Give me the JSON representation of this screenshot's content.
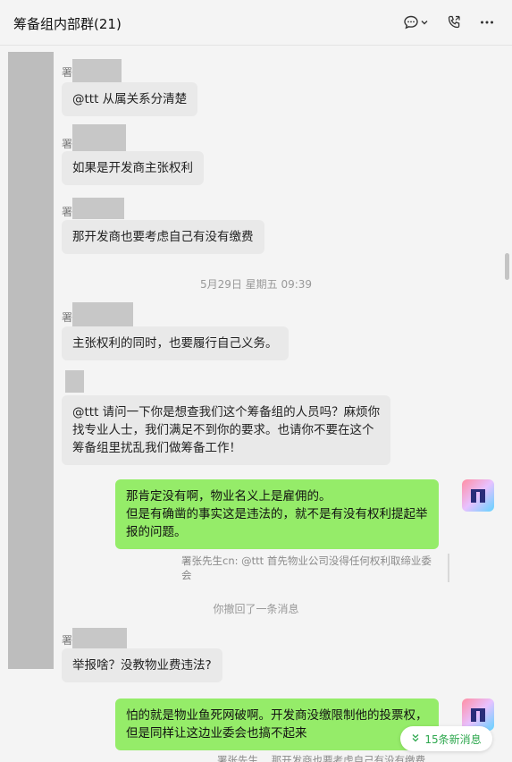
{
  "header": {
    "title": "筹备组内部群(21)"
  },
  "timestamp": "5月29日 星期五 09:39",
  "messages": {
    "m1": {
      "sender_initial": "署",
      "text": "@ttt 从属关系分清楚"
    },
    "m2": {
      "sender_initial": "署",
      "text": "如果是开发商主张权利"
    },
    "m3": {
      "sender_initial": "署",
      "text": "那开发商也要考虑自己有没有缴费"
    },
    "m4": {
      "sender_initial": "署",
      "text": "主张权利的同时，也要履行自己义务。"
    },
    "m5": {
      "sender_initial": "",
      "lines": [
        "@ttt 请问一下你是想查我们这个筹备组的人员吗？麻烦你",
        "找专业人士，我们满足不到你的要求。也请你不要在这个",
        "筹备组里扰乱我们做筹备工作！"
      ]
    },
    "m6": {
      "lines": [
        "那肯定没有啊，物业名义上是雇佣的。",
        "但是有确凿的事实这是违法的，就不是有没有权利提起举",
        "报的问题。"
      ],
      "quote_lines": [
        "署张先生cn: @ttt 首先物业公司没得任何权利取缔业委",
        "会"
      ]
    },
    "recall_notice": "你撤回了一条消息",
    "m7": {
      "sender_initial": "署",
      "text": "举报啥？没教物业费违法?"
    },
    "m8": {
      "lines": [
        "怕的就是物业鱼死网破啊。开发商没缴限制他的投票权，",
        "但是同样让这边业委会也搞不起来"
      ],
      "quote_partial": "署张先生...   那开发商也要考虑自己有没有缴费"
    }
  },
  "new_messages_label": "15条新消息",
  "icons": {
    "chat": "chat-bubble-icon",
    "dropdown": "chevron-down-icon",
    "call": "phone-icon",
    "more": "more-dots-icon",
    "new": "double-chevron-down-icon"
  },
  "colors": {
    "outgoing_bubble": "#95ec69",
    "incoming_bubble": "#e9e9e9",
    "accent_green": "#2fa84f"
  }
}
